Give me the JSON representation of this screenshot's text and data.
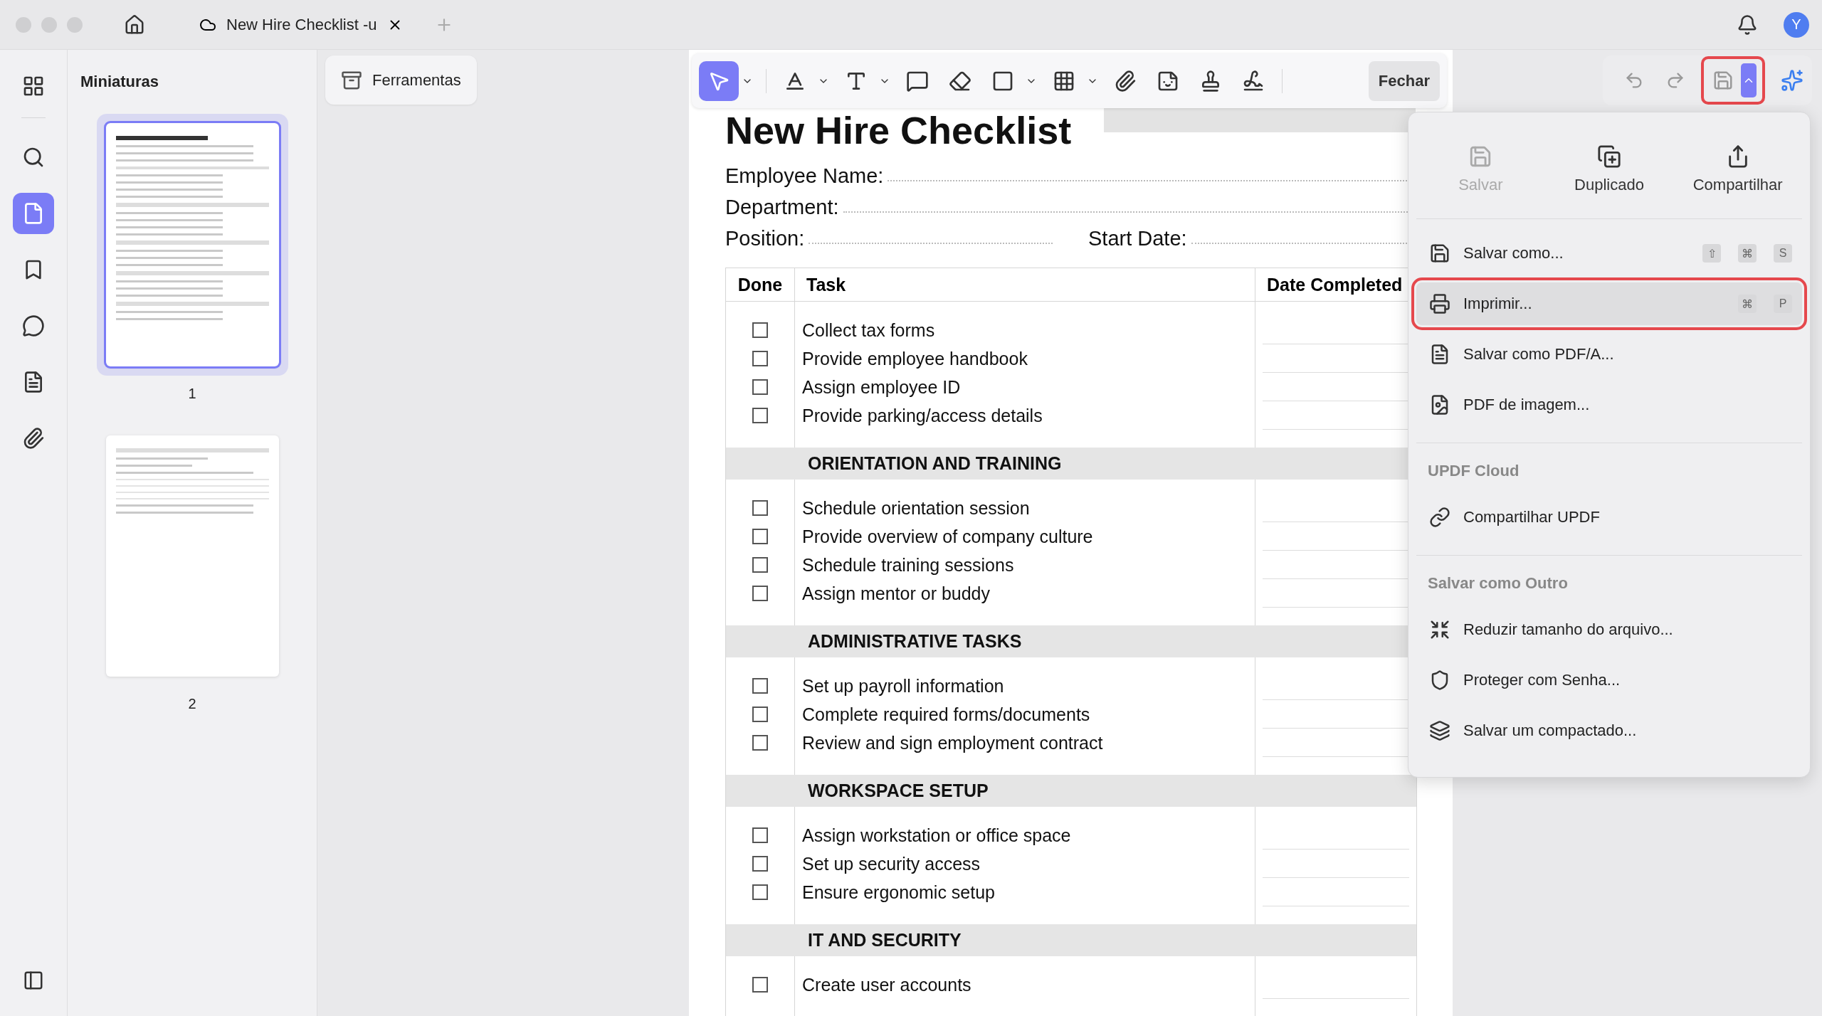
{
  "tab": {
    "title": "New Hire Checklist -u"
  },
  "sidebar": {
    "items": [
      {
        "selected": false
      },
      {
        "selected": false
      },
      {
        "selected": true
      },
      {
        "selected": false
      },
      {
        "selected": false
      },
      {
        "selected": false
      },
      {
        "selected": false
      }
    ]
  },
  "thumbnails": {
    "title": "Miniaturas",
    "pages": [
      {
        "label": "1",
        "selected": true
      },
      {
        "label": "2",
        "selected": false
      }
    ]
  },
  "tools_button": "Ferramentas",
  "toolbar": {
    "tools": [
      {
        "selected": true
      },
      {
        "selected": false
      },
      {
        "selected": false
      },
      {
        "selected": false
      },
      {
        "selected": false
      },
      {
        "selected": false
      },
      {
        "selected": false
      },
      {
        "selected": false
      },
      {
        "selected": false
      },
      {
        "selected": false
      },
      {
        "selected": false
      }
    ],
    "close": "Fechar"
  },
  "save_button": {
    "outlined": true
  },
  "avatar": "Y",
  "document": {
    "title": "New Hire Checklist",
    "fields": [
      {
        "label": "Employee Name:"
      },
      {
        "label": "Department:"
      },
      {
        "label": "Position:"
      },
      {
        "label": "Start Date:"
      }
    ],
    "columns": [
      "Done",
      "Task",
      "Date Completed"
    ],
    "sections": [
      {
        "tasks": [
          {
            "text": "Collect tax forms",
            "checked": false
          },
          {
            "text": "Provide employee handbook",
            "checked": false
          },
          {
            "text": "Assign employee ID",
            "checked": false
          },
          {
            "text": "Provide parking/access details",
            "checked": false
          }
        ]
      },
      {
        "heading": "ORIENTATION AND TRAINING",
        "tasks": [
          {
            "text": "Schedule orientation session",
            "checked": false
          },
          {
            "text": "Provide overview of company culture",
            "checked": false
          },
          {
            "text": "Schedule training sessions",
            "checked": false
          },
          {
            "text": "Assign mentor or buddy",
            "checked": false
          }
        ]
      },
      {
        "heading": "ADMINISTRATIVE TASKS",
        "tasks": [
          {
            "text": "Set up payroll information",
            "checked": false
          },
          {
            "text": "Complete required forms/documents",
            "checked": false
          },
          {
            "text": "Review and sign employment contract",
            "checked": false
          }
        ]
      },
      {
        "heading": "WORKSPACE SETUP",
        "tasks": [
          {
            "text": "Assign workstation or office space",
            "checked": false
          },
          {
            "text": "Set up security access",
            "checked": false
          },
          {
            "text": "Ensure ergonomic setup",
            "checked": false
          }
        ]
      },
      {
        "heading": "IT AND SECURITY",
        "tasks": [
          {
            "text": "Create user accounts",
            "checked": false
          }
        ]
      }
    ]
  },
  "menu": {
    "actions": [
      {
        "label": "Salvar",
        "disabled": true
      },
      {
        "label": "Duplicado",
        "disabled": false
      },
      {
        "label": "Compartilhar",
        "disabled": false
      }
    ],
    "groups": [
      {
        "items": [
          {
            "label": "Salvar como...",
            "keys": [
              "⇧",
              "⌘",
              "S"
            ],
            "selected": false,
            "outlined": false
          },
          {
            "label": "Imprimir...",
            "keys": [
              "⌘",
              "P"
            ],
            "selected": true,
            "outlined": true
          },
          {
            "label": "Salvar como PDF/A...",
            "selected": false,
            "outlined": false
          },
          {
            "label": "PDF de imagem...",
            "selected": false,
            "outlined": false
          }
        ]
      },
      {
        "heading": "UPDF Cloud",
        "items": [
          {
            "label": "Compartilhar UPDF",
            "selected": false,
            "outlined": false
          }
        ]
      },
      {
        "heading": "Salvar como Outro",
        "items": [
          {
            "label": "Reduzir tamanho do arquivo...",
            "selected": false,
            "outlined": false
          },
          {
            "label": "Proteger com Senha...",
            "selected": false,
            "outlined": false
          },
          {
            "label": "Salvar um compactado...",
            "selected": false,
            "outlined": false
          }
        ]
      }
    ]
  }
}
